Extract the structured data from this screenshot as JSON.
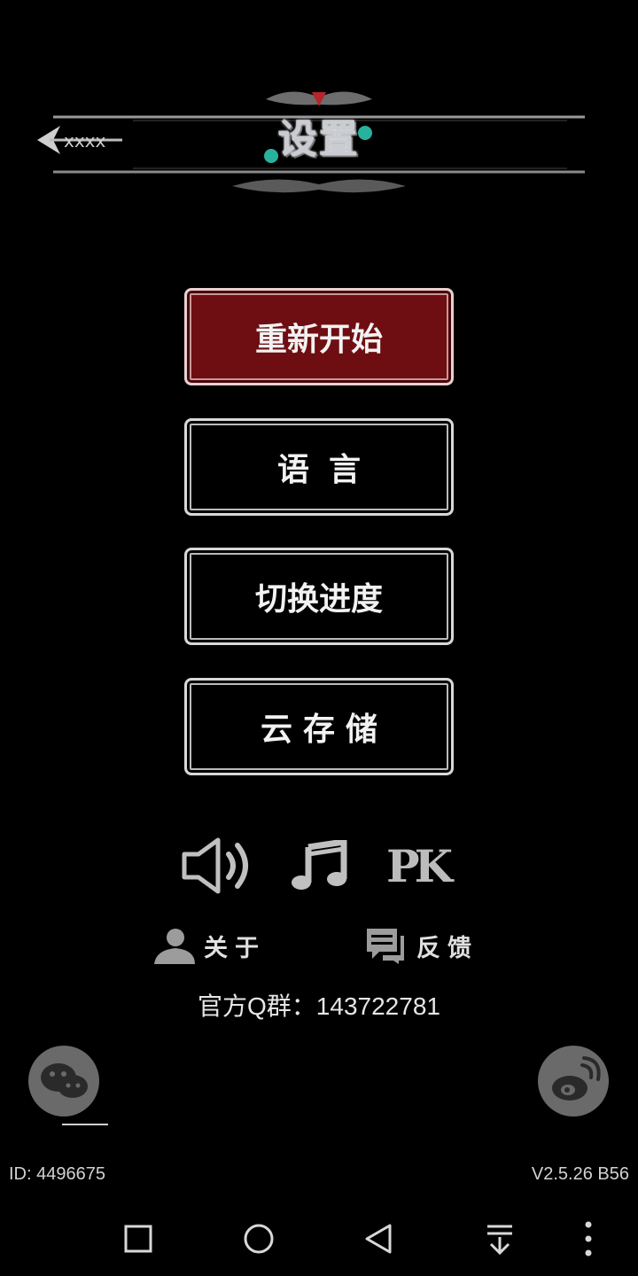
{
  "header": {
    "title": "设置",
    "back_icon": "back-arrow-icon"
  },
  "menu": {
    "items": [
      {
        "label": "重新开始",
        "active": true
      },
      {
        "label": "语言",
        "active": false
      },
      {
        "label": "切换进度",
        "active": false
      },
      {
        "label": "云存储",
        "active": false
      }
    ]
  },
  "toggles": {
    "sound_icon": "speaker-icon",
    "music_icon": "music-note-icon",
    "pk_label": "PK"
  },
  "links": {
    "about": "关于",
    "feedback": "反馈"
  },
  "qq_group": "官方Q群：143722781",
  "social": {
    "wechat_icon": "wechat-icon",
    "weibo_icon": "weibo-icon"
  },
  "footer": {
    "id": "ID: 4496675",
    "version": "V2.5.26 B56"
  },
  "colors": {
    "active_button": "#6e0e12",
    "background": "#000000",
    "icon_gray": "#6a6a6a"
  }
}
